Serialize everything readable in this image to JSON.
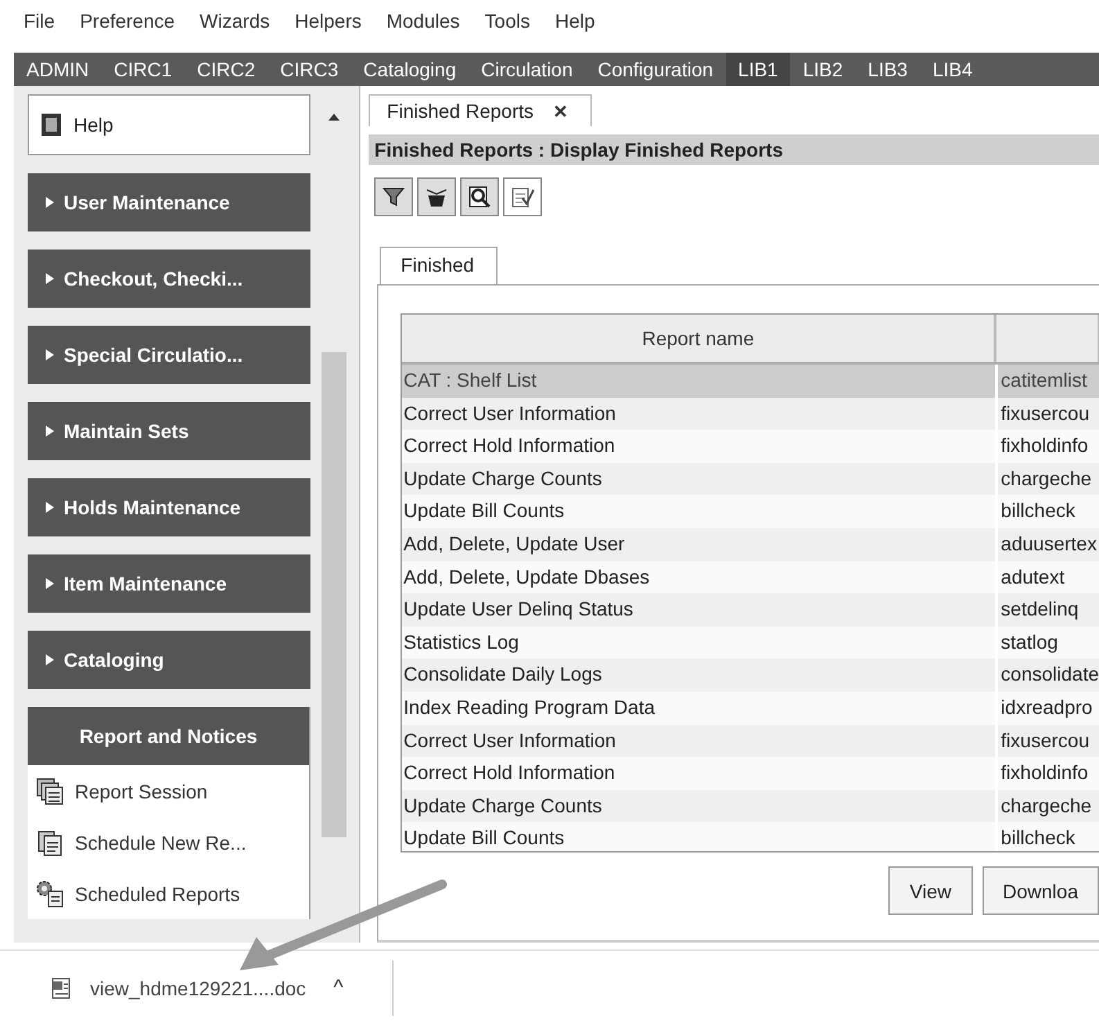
{
  "menu_bar": [
    "File",
    "Preference",
    "Wizards",
    "Helpers",
    "Modules",
    "Tools",
    "Help"
  ],
  "module_tabs": [
    {
      "label": "ADMIN",
      "selected": false
    },
    {
      "label": "CIRC1",
      "selected": false
    },
    {
      "label": "CIRC2",
      "selected": false
    },
    {
      "label": "CIRC3",
      "selected": false
    },
    {
      "label": "Cataloging",
      "selected": false
    },
    {
      "label": "Circulation",
      "selected": false
    },
    {
      "label": "Configuration",
      "selected": false
    },
    {
      "label": "LIB1",
      "selected": true
    },
    {
      "label": "LIB2",
      "selected": false
    },
    {
      "label": "LIB3",
      "selected": false
    },
    {
      "label": "LIB4",
      "selected": false
    }
  ],
  "sidebar": {
    "help": "Help",
    "groups": [
      {
        "label": "User Maintenance",
        "expanded": false
      },
      {
        "label": "Checkout, Checki...",
        "expanded": false
      },
      {
        "label": "Special Circulatio...",
        "expanded": false
      },
      {
        "label": "Maintain Sets",
        "expanded": false
      },
      {
        "label": "Holds Maintenance",
        "expanded": false
      },
      {
        "label": "Item Maintenance",
        "expanded": false
      },
      {
        "label": "Cataloging",
        "expanded": false
      },
      {
        "label": "Report and Notices",
        "expanded": true,
        "items": [
          {
            "label": "Report Session",
            "kind": "session"
          },
          {
            "label": "Schedule New Re...",
            "kind": "schedule"
          },
          {
            "label": "Scheduled Reports",
            "kind": "scheduled"
          }
        ]
      }
    ]
  },
  "document_tab": {
    "label": "Finished Reports",
    "close": "✕"
  },
  "panel_title": "Finished Reports : Display Finished Reports",
  "inner_tab": "Finished",
  "table": {
    "columns": [
      "Report name"
    ],
    "rows": [
      {
        "name": "CAT : Shelf List",
        "file": "catitemlist",
        "selected": true
      },
      {
        "name": "Correct User Information",
        "file": "fixusercou",
        "selected": false
      },
      {
        "name": "Correct Hold Information",
        "file": "fixholdinfo",
        "selected": false
      },
      {
        "name": "Update Charge Counts",
        "file": "chargeche",
        "selected": false
      },
      {
        "name": "Update Bill Counts",
        "file": "billcheck",
        "selected": false
      },
      {
        "name": "Add, Delete, Update User",
        "file": "aduusertex",
        "selected": false
      },
      {
        "name": "Add, Delete, Update Dbases",
        "file": "adutext",
        "selected": false
      },
      {
        "name": "Update User Delinq Status",
        "file": "setdelinq",
        "selected": false
      },
      {
        "name": "Statistics Log",
        "file": "statlog",
        "selected": false
      },
      {
        "name": "Consolidate Daily Logs",
        "file": "consolidate",
        "selected": false
      },
      {
        "name": "Index Reading Program Data",
        "file": "idxreadpro",
        "selected": false
      },
      {
        "name": "Correct User Information",
        "file": "fixusercou",
        "selected": false
      },
      {
        "name": "Correct Hold Information",
        "file": "fixholdinfo",
        "selected": false
      },
      {
        "name": "Update Charge Counts",
        "file": "chargeche",
        "selected": false
      },
      {
        "name": "Update Bill Counts",
        "file": "billcheck",
        "selected": false
      }
    ]
  },
  "buttons": [
    "View",
    "Downloa"
  ],
  "download_bar": {
    "file": "view_hdme129221....doc",
    "caret": "^"
  }
}
